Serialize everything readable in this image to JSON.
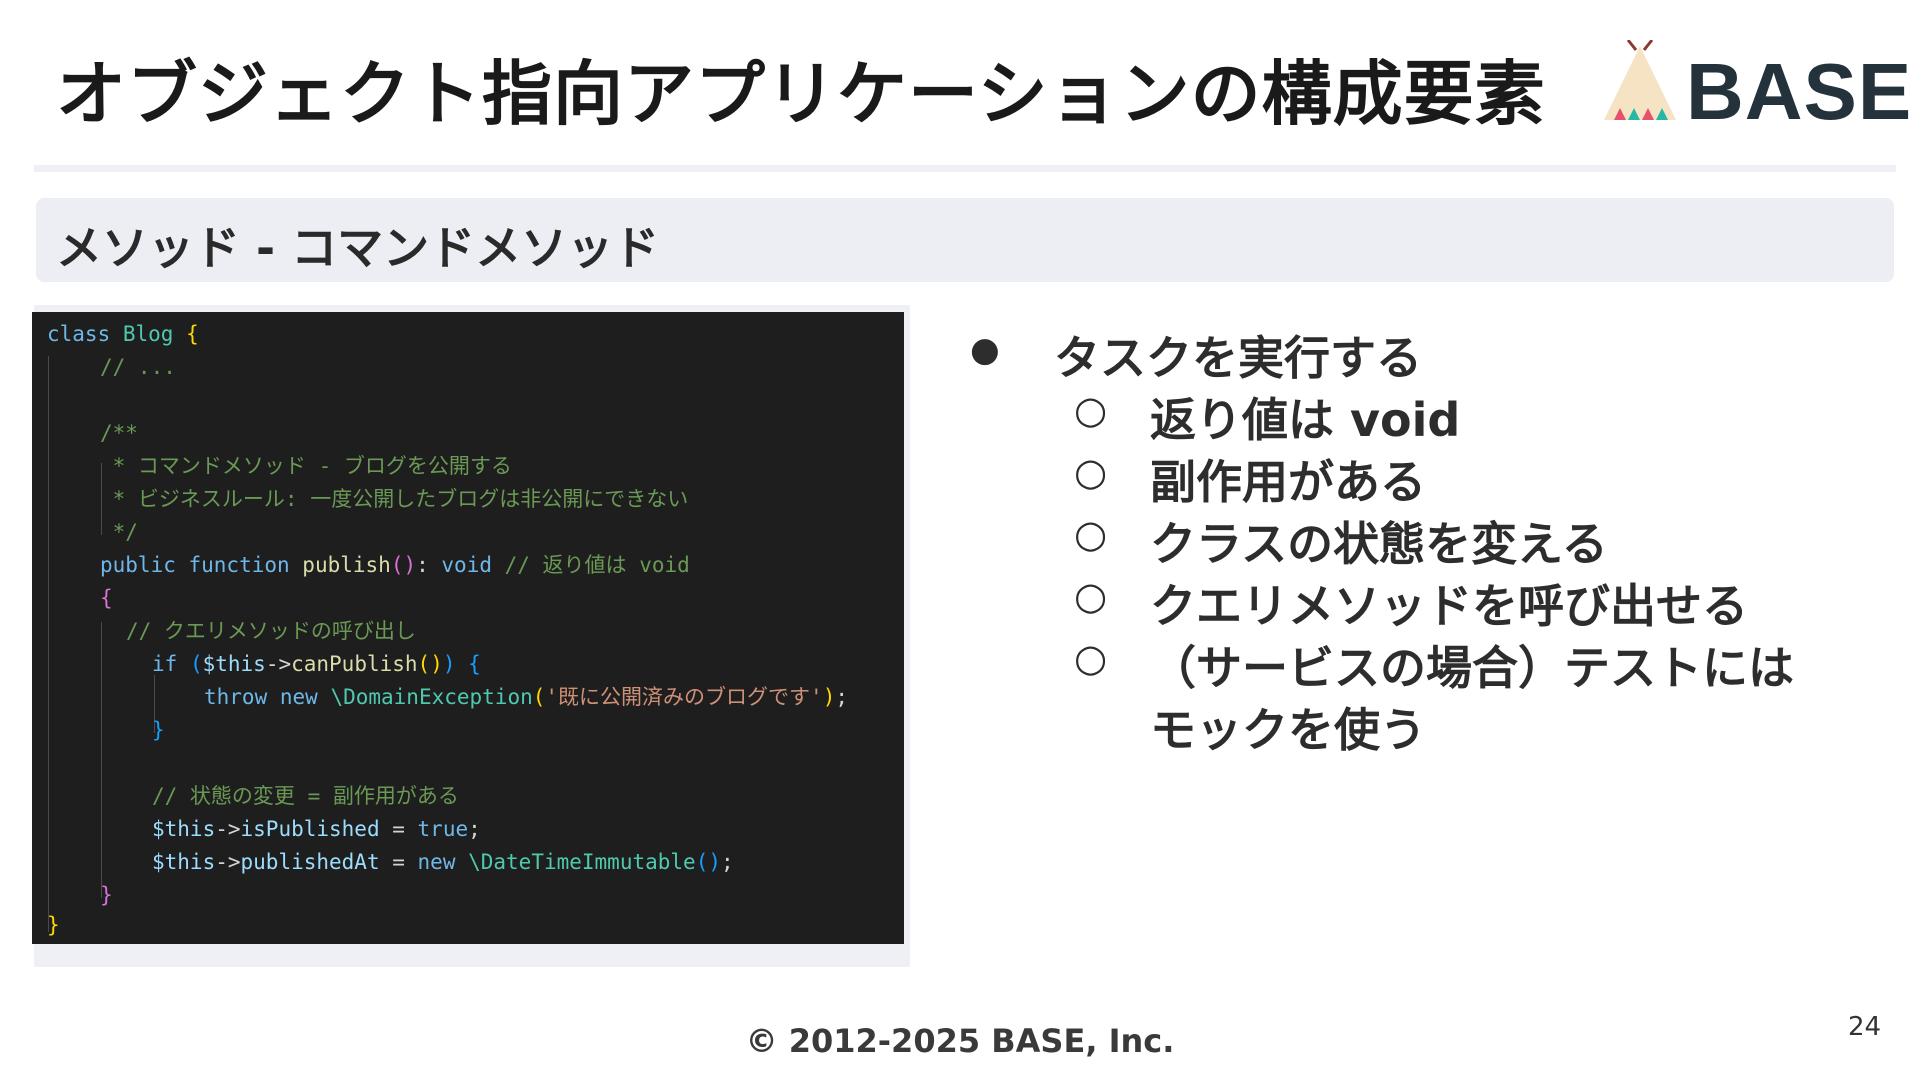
{
  "slide": {
    "title": "オブジェクト指向アプリケーションの構成要素",
    "section_title": "メソッド - コマンドメソッド",
    "footer": "© 2012-2025 BASE, Inc.",
    "page_number": "24"
  },
  "logo": {
    "text": "BASE",
    "icon": "teepee-icon",
    "text_color": "#24333b"
  },
  "code": {
    "language": "php",
    "lines": {
      "l01a": "class",
      "l01b": " Blog ",
      "l01c": "{",
      "l02": "// ...",
      "l04": "/**",
      "l05": " * コマンドメソッド - ブログを公開する",
      "l06": " * ビジネスルール: 一度公開したブログは非公開にできない",
      "l07": " */",
      "l08a": "public function",
      "l08b": " publish",
      "l08c": "()",
      "l08d": ": ",
      "l08e": "void",
      "l08f": " // 返り値は void",
      "l09": "{",
      "l10": "// クエリメソッドの呼び出し",
      "l11a": "if ",
      "l11b": "(",
      "l11c": "$this",
      "l11d": "->",
      "l11e": "canPublish",
      "l11f": "()",
      "l11g": ")",
      "l11h": " {",
      "l12a": "throw new",
      "l12b": " \\DomainException",
      "l12c": "(",
      "l12d": "'既に公開済みのブログです'",
      "l12e": ")",
      "l12f": ";",
      "l13": "}",
      "l15": "// 状態の変更 = 副作用がある",
      "l16a": "$this",
      "l16b": "->",
      "l16c": "isPublished",
      "l16d": " = ",
      "l16e": "true",
      "l16f": ";",
      "l17a": "$this",
      "l17b": "->",
      "l17c": "publishedAt",
      "l17d": " = ",
      "l17e": "new",
      "l17f": " \\DateTimeImmutable",
      "l17g": "()",
      "l17h": ";",
      "l18": "}",
      "l19": "}"
    }
  },
  "bullets": {
    "main": "タスクを実行する",
    "sub": [
      "返り値は void",
      "副作用がある",
      "クラスの状態を変える",
      "クエリメソッドを呼び出せる",
      "（サービスの場合）テストには",
      "モックを使う"
    ],
    "filled_marker": "●",
    "hollow_marker": "○"
  },
  "colors": {
    "code_background": "#1e1e1e",
    "section_background": "#eceef3",
    "comment": "#6a9955",
    "keyword": "#6fb7e8",
    "string": "#ce9178"
  }
}
